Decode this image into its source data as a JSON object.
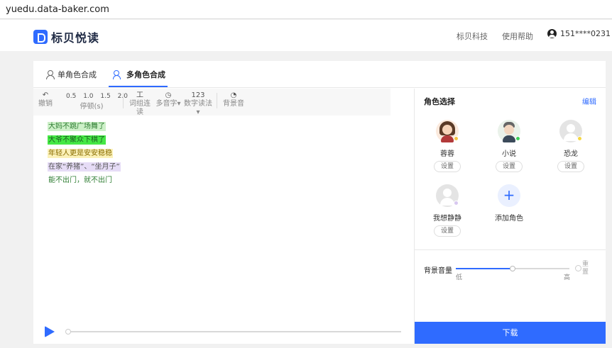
{
  "browser": {
    "url": "yuedu.data-baker.com"
  },
  "header": {
    "brand": "标贝悦读",
    "links": [
      "标贝科技",
      "使用帮助"
    ],
    "user": "151****0231"
  },
  "tabs": [
    {
      "label": "单角色合成",
      "active": false
    },
    {
      "label": "多角色合成",
      "active": true
    }
  ],
  "toolbar": {
    "undo": {
      "icon": "undo-icon",
      "label": "撤销"
    },
    "speeds": [
      "0.5",
      "1.0",
      "1.5",
      "2.0"
    ],
    "pause_label": "停顿(s)",
    "word_link": {
      "icon_text": "工",
      "label": "词组连读"
    },
    "polyphone": {
      "icon": "clock-icon",
      "label": "多音字"
    },
    "number": {
      "icon_text": "123",
      "label": "数字读法"
    },
    "bgm": {
      "icon": "gauge-icon",
      "label": "背景音"
    }
  },
  "editor_lines": [
    "大妈不跳广场舞了",
    "大爷不聚众下棋了",
    "年轻人更是安安稳稳",
    "在家“养猪”、“坐月子”",
    "能不出门，就不出门"
  ],
  "roles_panel": {
    "title": "角色选择",
    "edit": "编辑",
    "set_label": "设置",
    "roles": [
      {
        "name": "蓉蓉",
        "status_color": "#f5c542"
      },
      {
        "name": "小说",
        "status_color": "#3ecf5a"
      },
      {
        "name": "恐龙",
        "status_color": "#f5d742"
      },
      {
        "name": "我想静静",
        "status_color": "#d8c8f0"
      }
    ],
    "add_role": "添加角色"
  },
  "volume": {
    "label": "背景音量",
    "low": "低",
    "high": "高",
    "reset": "重置",
    "level": 0.5
  },
  "download": "下载",
  "colors": {
    "accent": "#2f6bff"
  }
}
